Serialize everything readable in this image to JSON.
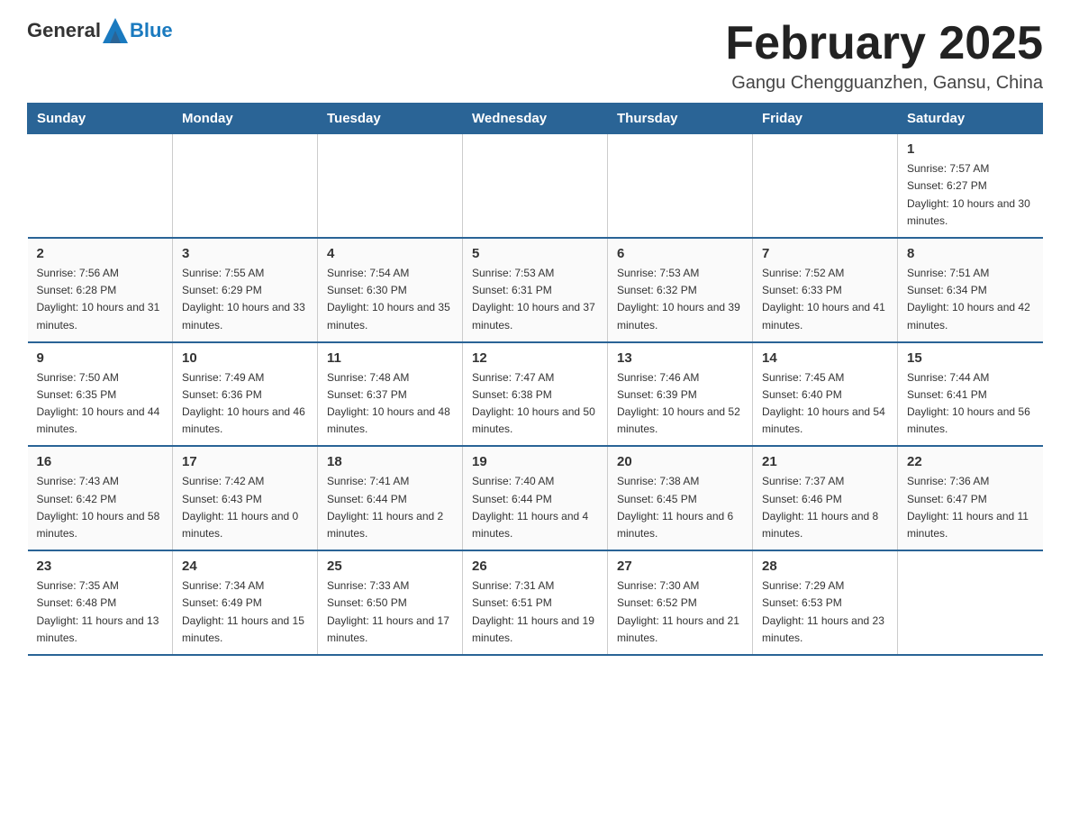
{
  "header": {
    "logo_general": "General",
    "logo_blue": "Blue",
    "month_year": "February 2025",
    "location": "Gangu Chengguanzhen, Gansu, China"
  },
  "days_of_week": [
    "Sunday",
    "Monday",
    "Tuesday",
    "Wednesday",
    "Thursday",
    "Friday",
    "Saturday"
  ],
  "weeks": [
    [
      {
        "day": "",
        "sunrise": "",
        "sunset": "",
        "daylight": ""
      },
      {
        "day": "",
        "sunrise": "",
        "sunset": "",
        "daylight": ""
      },
      {
        "day": "",
        "sunrise": "",
        "sunset": "",
        "daylight": ""
      },
      {
        "day": "",
        "sunrise": "",
        "sunset": "",
        "daylight": ""
      },
      {
        "day": "",
        "sunrise": "",
        "sunset": "",
        "daylight": ""
      },
      {
        "day": "",
        "sunrise": "",
        "sunset": "",
        "daylight": ""
      },
      {
        "day": "1",
        "sunrise": "Sunrise: 7:57 AM",
        "sunset": "Sunset: 6:27 PM",
        "daylight": "Daylight: 10 hours and 30 minutes."
      }
    ],
    [
      {
        "day": "2",
        "sunrise": "Sunrise: 7:56 AM",
        "sunset": "Sunset: 6:28 PM",
        "daylight": "Daylight: 10 hours and 31 minutes."
      },
      {
        "day": "3",
        "sunrise": "Sunrise: 7:55 AM",
        "sunset": "Sunset: 6:29 PM",
        "daylight": "Daylight: 10 hours and 33 minutes."
      },
      {
        "day": "4",
        "sunrise": "Sunrise: 7:54 AM",
        "sunset": "Sunset: 6:30 PM",
        "daylight": "Daylight: 10 hours and 35 minutes."
      },
      {
        "day": "5",
        "sunrise": "Sunrise: 7:53 AM",
        "sunset": "Sunset: 6:31 PM",
        "daylight": "Daylight: 10 hours and 37 minutes."
      },
      {
        "day": "6",
        "sunrise": "Sunrise: 7:53 AM",
        "sunset": "Sunset: 6:32 PM",
        "daylight": "Daylight: 10 hours and 39 minutes."
      },
      {
        "day": "7",
        "sunrise": "Sunrise: 7:52 AM",
        "sunset": "Sunset: 6:33 PM",
        "daylight": "Daylight: 10 hours and 41 minutes."
      },
      {
        "day": "8",
        "sunrise": "Sunrise: 7:51 AM",
        "sunset": "Sunset: 6:34 PM",
        "daylight": "Daylight: 10 hours and 42 minutes."
      }
    ],
    [
      {
        "day": "9",
        "sunrise": "Sunrise: 7:50 AM",
        "sunset": "Sunset: 6:35 PM",
        "daylight": "Daylight: 10 hours and 44 minutes."
      },
      {
        "day": "10",
        "sunrise": "Sunrise: 7:49 AM",
        "sunset": "Sunset: 6:36 PM",
        "daylight": "Daylight: 10 hours and 46 minutes."
      },
      {
        "day": "11",
        "sunrise": "Sunrise: 7:48 AM",
        "sunset": "Sunset: 6:37 PM",
        "daylight": "Daylight: 10 hours and 48 minutes."
      },
      {
        "day": "12",
        "sunrise": "Sunrise: 7:47 AM",
        "sunset": "Sunset: 6:38 PM",
        "daylight": "Daylight: 10 hours and 50 minutes."
      },
      {
        "day": "13",
        "sunrise": "Sunrise: 7:46 AM",
        "sunset": "Sunset: 6:39 PM",
        "daylight": "Daylight: 10 hours and 52 minutes."
      },
      {
        "day": "14",
        "sunrise": "Sunrise: 7:45 AM",
        "sunset": "Sunset: 6:40 PM",
        "daylight": "Daylight: 10 hours and 54 minutes."
      },
      {
        "day": "15",
        "sunrise": "Sunrise: 7:44 AM",
        "sunset": "Sunset: 6:41 PM",
        "daylight": "Daylight: 10 hours and 56 minutes."
      }
    ],
    [
      {
        "day": "16",
        "sunrise": "Sunrise: 7:43 AM",
        "sunset": "Sunset: 6:42 PM",
        "daylight": "Daylight: 10 hours and 58 minutes."
      },
      {
        "day": "17",
        "sunrise": "Sunrise: 7:42 AM",
        "sunset": "Sunset: 6:43 PM",
        "daylight": "Daylight: 11 hours and 0 minutes."
      },
      {
        "day": "18",
        "sunrise": "Sunrise: 7:41 AM",
        "sunset": "Sunset: 6:44 PM",
        "daylight": "Daylight: 11 hours and 2 minutes."
      },
      {
        "day": "19",
        "sunrise": "Sunrise: 7:40 AM",
        "sunset": "Sunset: 6:44 PM",
        "daylight": "Daylight: 11 hours and 4 minutes."
      },
      {
        "day": "20",
        "sunrise": "Sunrise: 7:38 AM",
        "sunset": "Sunset: 6:45 PM",
        "daylight": "Daylight: 11 hours and 6 minutes."
      },
      {
        "day": "21",
        "sunrise": "Sunrise: 7:37 AM",
        "sunset": "Sunset: 6:46 PM",
        "daylight": "Daylight: 11 hours and 8 minutes."
      },
      {
        "day": "22",
        "sunrise": "Sunrise: 7:36 AM",
        "sunset": "Sunset: 6:47 PM",
        "daylight": "Daylight: 11 hours and 11 minutes."
      }
    ],
    [
      {
        "day": "23",
        "sunrise": "Sunrise: 7:35 AM",
        "sunset": "Sunset: 6:48 PM",
        "daylight": "Daylight: 11 hours and 13 minutes."
      },
      {
        "day": "24",
        "sunrise": "Sunrise: 7:34 AM",
        "sunset": "Sunset: 6:49 PM",
        "daylight": "Daylight: 11 hours and 15 minutes."
      },
      {
        "day": "25",
        "sunrise": "Sunrise: 7:33 AM",
        "sunset": "Sunset: 6:50 PM",
        "daylight": "Daylight: 11 hours and 17 minutes."
      },
      {
        "day": "26",
        "sunrise": "Sunrise: 7:31 AM",
        "sunset": "Sunset: 6:51 PM",
        "daylight": "Daylight: 11 hours and 19 minutes."
      },
      {
        "day": "27",
        "sunrise": "Sunrise: 7:30 AM",
        "sunset": "Sunset: 6:52 PM",
        "daylight": "Daylight: 11 hours and 21 minutes."
      },
      {
        "day": "28",
        "sunrise": "Sunrise: 7:29 AM",
        "sunset": "Sunset: 6:53 PM",
        "daylight": "Daylight: 11 hours and 23 minutes."
      },
      {
        "day": "",
        "sunrise": "",
        "sunset": "",
        "daylight": ""
      }
    ]
  ]
}
